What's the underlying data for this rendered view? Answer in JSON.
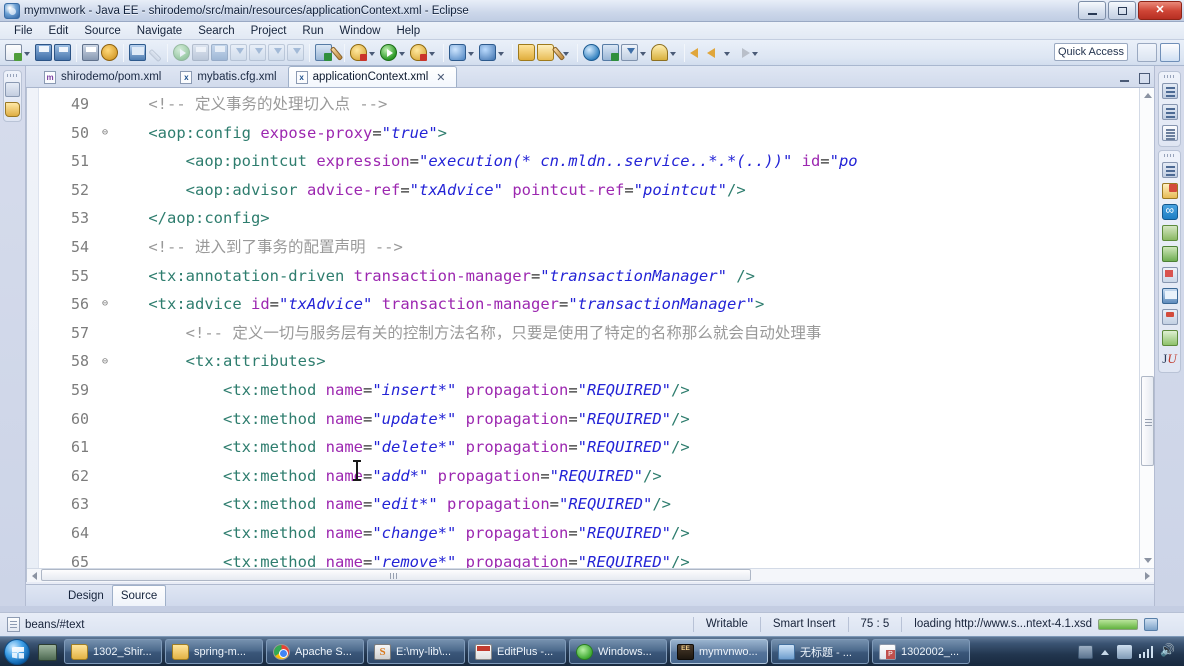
{
  "window": {
    "title": "mymvnwork - Java EE - shirodemo/src/main/resources/applicationContext.xml - Eclipse",
    "minimize_label": "Minimize",
    "maximize_label": "Maximize",
    "close_label": "✕"
  },
  "menu": {
    "items": [
      "File",
      "Edit",
      "Source",
      "Navigate",
      "Search",
      "Project",
      "Run",
      "Window",
      "Help"
    ]
  },
  "toolbar": {
    "quick_access_label": "Quick Access",
    "icons": [
      "new-wizard-icon",
      "new-dropdown-arrow",
      "save-icon",
      "save-all-icon",
      "print-icon",
      "bug-icon",
      "open-console-icon",
      "link-icon",
      "resume-icon",
      "suspend-icon",
      "terminate-icon",
      "step-into-icon",
      "step-over-icon",
      "step-return-icon",
      "drop-to-frame-icon",
      "open-task-icon",
      "skip-breakpoints-icon",
      "external-tools-icon",
      "run-icon",
      "debug-icon",
      "coverage-icon",
      "validate-icon",
      "new-folder-icon",
      "open-folder-icon",
      "brush-icon",
      "globe-icon",
      "perspective-icon",
      "download-icon",
      "key-icon",
      "back-icon",
      "forward-icon",
      "next-annotation-icon"
    ],
    "perspective_buttons": [
      "open-perspective-icon",
      "java-ee-perspective-icon"
    ]
  },
  "editor": {
    "tabs": [
      {
        "label": "shirodemo/pom.xml",
        "icon": "maven-file-icon",
        "icon_letter": "m",
        "active": false,
        "closable": false
      },
      {
        "label": "mybatis.cfg.xml",
        "icon": "xml-file-icon",
        "icon_letter": "x",
        "active": false,
        "closable": false
      },
      {
        "label": "applicationContext.xml",
        "icon": "xml-file-icon",
        "icon_letter": "x",
        "active": true,
        "closable": true
      }
    ],
    "close_glyph": "✕",
    "bottom_tabs": [
      {
        "label": "Design",
        "active": false
      },
      {
        "label": "Source",
        "active": true
      }
    ],
    "lines": [
      {
        "number": "49",
        "folding": "",
        "tokens": [
          {
            "t": "    ",
            "c": "plain"
          },
          {
            "t": "<!-- 定义事务的处理切入点 -->",
            "c": "comment"
          }
        ]
      },
      {
        "number": "50",
        "folding": "-",
        "tokens": [
          {
            "t": "    ",
            "c": "plain"
          },
          {
            "t": "<aop:config",
            "c": "tag"
          },
          {
            "t": " ",
            "c": "plain"
          },
          {
            "t": "expose-proxy",
            "c": "attr"
          },
          {
            "t": "=",
            "c": "punct"
          },
          {
            "t": "\"true\"",
            "c": "val"
          },
          {
            "t": ">",
            "c": "tag"
          }
        ]
      },
      {
        "number": "51",
        "folding": "",
        "tokens": [
          {
            "t": "        ",
            "c": "plain"
          },
          {
            "t": "<aop:pointcut",
            "c": "tag"
          },
          {
            "t": " ",
            "c": "plain"
          },
          {
            "t": "expression",
            "c": "attr"
          },
          {
            "t": "=",
            "c": "punct"
          },
          {
            "t": "\"execution(* cn.mldn..service..*.*(..))\"",
            "c": "val"
          },
          {
            "t": " ",
            "c": "plain"
          },
          {
            "t": "id",
            "c": "attr"
          },
          {
            "t": "=",
            "c": "punct"
          },
          {
            "t": "\"po",
            "c": "val"
          }
        ]
      },
      {
        "number": "52",
        "folding": "",
        "tokens": [
          {
            "t": "        ",
            "c": "plain"
          },
          {
            "t": "<aop:advisor",
            "c": "tag"
          },
          {
            "t": " ",
            "c": "plain"
          },
          {
            "t": "advice-ref",
            "c": "attr"
          },
          {
            "t": "=",
            "c": "punct"
          },
          {
            "t": "\"txAdvice\"",
            "c": "val"
          },
          {
            "t": " ",
            "c": "plain"
          },
          {
            "t": "pointcut-ref",
            "c": "attr"
          },
          {
            "t": "=",
            "c": "punct"
          },
          {
            "t": "\"pointcut\"",
            "c": "val"
          },
          {
            "t": "/>",
            "c": "tag"
          }
        ]
      },
      {
        "number": "53",
        "folding": "",
        "tokens": [
          {
            "t": "    ",
            "c": "plain"
          },
          {
            "t": "</aop:config>",
            "c": "tag"
          }
        ]
      },
      {
        "number": "54",
        "folding": "",
        "tokens": [
          {
            "t": "    ",
            "c": "plain"
          },
          {
            "t": "<!-- 进入到了事务的配置声明 -->",
            "c": "comment"
          }
        ]
      },
      {
        "number": "55",
        "folding": "",
        "tokens": [
          {
            "t": "    ",
            "c": "plain"
          },
          {
            "t": "<tx:annotation-driven",
            "c": "tag"
          },
          {
            "t": " ",
            "c": "plain"
          },
          {
            "t": "transaction-manager",
            "c": "attr"
          },
          {
            "t": "=",
            "c": "punct"
          },
          {
            "t": "\"transactionManager\"",
            "c": "val"
          },
          {
            "t": " ",
            "c": "plain"
          },
          {
            "t": "/>",
            "c": "tag"
          }
        ]
      },
      {
        "number": "56",
        "folding": "-",
        "tokens": [
          {
            "t": "    ",
            "c": "plain"
          },
          {
            "t": "<tx:advice",
            "c": "tag"
          },
          {
            "t": " ",
            "c": "plain"
          },
          {
            "t": "id",
            "c": "attr"
          },
          {
            "t": "=",
            "c": "punct"
          },
          {
            "t": "\"txAdvice\"",
            "c": "val"
          },
          {
            "t": " ",
            "c": "plain"
          },
          {
            "t": "transaction-manager",
            "c": "attr"
          },
          {
            "t": "=",
            "c": "punct"
          },
          {
            "t": "\"transactionManager\"",
            "c": "val"
          },
          {
            "t": ">",
            "c": "tag"
          }
        ]
      },
      {
        "number": "57",
        "folding": "",
        "tokens": [
          {
            "t": "        ",
            "c": "plain"
          },
          {
            "t": "<!-- 定义一切与服务层有关的控制方法名称，只要是使用了特定的名称那么就会自动处理事",
            "c": "comment"
          }
        ]
      },
      {
        "number": "58",
        "folding": "-",
        "tokens": [
          {
            "t": "        ",
            "c": "plain"
          },
          {
            "t": "<tx:attributes>",
            "c": "tag"
          }
        ]
      },
      {
        "number": "59",
        "folding": "",
        "tokens": [
          {
            "t": "            ",
            "c": "plain"
          },
          {
            "t": "<tx:method",
            "c": "tag"
          },
          {
            "t": " ",
            "c": "plain"
          },
          {
            "t": "name",
            "c": "attr"
          },
          {
            "t": "=",
            "c": "punct"
          },
          {
            "t": "\"insert*\"",
            "c": "val"
          },
          {
            "t": " ",
            "c": "plain"
          },
          {
            "t": "propagation",
            "c": "attr"
          },
          {
            "t": "=",
            "c": "punct"
          },
          {
            "t": "\"REQUIRED\"",
            "c": "val"
          },
          {
            "t": "/>",
            "c": "tag"
          }
        ]
      },
      {
        "number": "60",
        "folding": "",
        "tokens": [
          {
            "t": "            ",
            "c": "plain"
          },
          {
            "t": "<tx:method",
            "c": "tag"
          },
          {
            "t": " ",
            "c": "plain"
          },
          {
            "t": "name",
            "c": "attr"
          },
          {
            "t": "=",
            "c": "punct"
          },
          {
            "t": "\"update*\"",
            "c": "val"
          },
          {
            "t": " ",
            "c": "plain"
          },
          {
            "t": "propagation",
            "c": "attr"
          },
          {
            "t": "=",
            "c": "punct"
          },
          {
            "t": "\"REQUIRED\"",
            "c": "val"
          },
          {
            "t": "/>",
            "c": "tag"
          }
        ]
      },
      {
        "number": "61",
        "folding": "",
        "tokens": [
          {
            "t": "            ",
            "c": "plain"
          },
          {
            "t": "<tx:method",
            "c": "tag"
          },
          {
            "t": " ",
            "c": "plain"
          },
          {
            "t": "name",
            "c": "attr"
          },
          {
            "t": "=",
            "c": "punct"
          },
          {
            "t": "\"delete*\"",
            "c": "val"
          },
          {
            "t": " ",
            "c": "plain"
          },
          {
            "t": "propagation",
            "c": "attr"
          },
          {
            "t": "=",
            "c": "punct"
          },
          {
            "t": "\"REQUIRED\"",
            "c": "val"
          },
          {
            "t": "/>",
            "c": "tag"
          }
        ]
      },
      {
        "number": "62",
        "folding": "",
        "tokens": [
          {
            "t": "            ",
            "c": "plain"
          },
          {
            "t": "<tx:method",
            "c": "tag"
          },
          {
            "t": " ",
            "c": "plain"
          },
          {
            "t": "name",
            "c": "attr"
          },
          {
            "t": "=",
            "c": "punct"
          },
          {
            "t": "\"add*\"",
            "c": "val"
          },
          {
            "t": " ",
            "c": "plain"
          },
          {
            "t": "propagation",
            "c": "attr"
          },
          {
            "t": "=",
            "c": "punct"
          },
          {
            "t": "\"REQUIRED\"",
            "c": "val"
          },
          {
            "t": "/>",
            "c": "tag"
          }
        ]
      },
      {
        "number": "63",
        "folding": "",
        "tokens": [
          {
            "t": "            ",
            "c": "plain"
          },
          {
            "t": "<tx:method",
            "c": "tag"
          },
          {
            "t": " ",
            "c": "plain"
          },
          {
            "t": "name",
            "c": "attr"
          },
          {
            "t": "=",
            "c": "punct"
          },
          {
            "t": "\"edit*\"",
            "c": "val"
          },
          {
            "t": " ",
            "c": "plain"
          },
          {
            "t": "propagation",
            "c": "attr"
          },
          {
            "t": "=",
            "c": "punct"
          },
          {
            "t": "\"REQUIRED\"",
            "c": "val"
          },
          {
            "t": "/>",
            "c": "tag"
          }
        ]
      },
      {
        "number": "64",
        "folding": "",
        "tokens": [
          {
            "t": "            ",
            "c": "plain"
          },
          {
            "t": "<tx:method",
            "c": "tag"
          },
          {
            "t": " ",
            "c": "plain"
          },
          {
            "t": "name",
            "c": "attr"
          },
          {
            "t": "=",
            "c": "punct"
          },
          {
            "t": "\"change*\"",
            "c": "val"
          },
          {
            "t": " ",
            "c": "plain"
          },
          {
            "t": "propagation",
            "c": "attr"
          },
          {
            "t": "=",
            "c": "punct"
          },
          {
            "t": "\"REQUIRED\"",
            "c": "val"
          },
          {
            "t": "/>",
            "c": "tag"
          }
        ]
      },
      {
        "number": "65",
        "folding": "",
        "tokens": [
          {
            "t": "            ",
            "c": "plain"
          },
          {
            "t": "<tx:method",
            "c": "tag"
          },
          {
            "t": " ",
            "c": "plain"
          },
          {
            "t": "name",
            "c": "attr"
          },
          {
            "t": "=",
            "c": "punct"
          },
          {
            "t": "\"remove*\"",
            "c": "val"
          },
          {
            "t": " ",
            "c": "plain"
          },
          {
            "t": "propagation",
            "c": "attr"
          },
          {
            "t": "=",
            "c": "punct"
          },
          {
            "t": "\"REQUIRED\"",
            "c": "val"
          },
          {
            "t": "/>",
            "c": "tag"
          }
        ]
      }
    ]
  },
  "status": {
    "breadcrumb": "beans/#text",
    "writable": "Writable",
    "insert_mode": "Smart Insert",
    "cursor_position": "75 : 5",
    "loading": "loading http://www.s...ntext-4.1.xsd"
  },
  "taskbar": {
    "buttons": [
      {
        "label": "1302_Shir...",
        "icon": "folder-icon",
        "active": false
      },
      {
        "label": "spring-m...",
        "icon": "folder-icon",
        "active": false
      },
      {
        "label": "Apache S...",
        "icon": "chrome-icon",
        "active": false
      },
      {
        "label": "E:\\my-lib\\...",
        "icon": "sublime-icon",
        "active": false
      },
      {
        "label": "EditPlus -...",
        "icon": "editplus-icon",
        "active": false
      },
      {
        "label": "Windows...",
        "icon": "windows-media-icon",
        "active": false
      },
      {
        "label": "mymvnwo...",
        "icon": "eclipse-icon",
        "active": true
      },
      {
        "label": "无标题 - ...",
        "icon": "book-icon",
        "active": false
      },
      {
        "label": "1302002_...",
        "icon": "powerpoint-icon",
        "active": false
      }
    ],
    "tray_icons": [
      "hardware-icon",
      "show-desktop-icon",
      "network-icon",
      "signal-icon",
      "volume-icon"
    ]
  },
  "colors": {
    "accent": "#2323d6",
    "tag": "#2e7d6e",
    "attr": "#9c27b0",
    "comment": "#999999",
    "titlebar_bg": "#ccd7ea",
    "close_button": "#cf4536"
  }
}
